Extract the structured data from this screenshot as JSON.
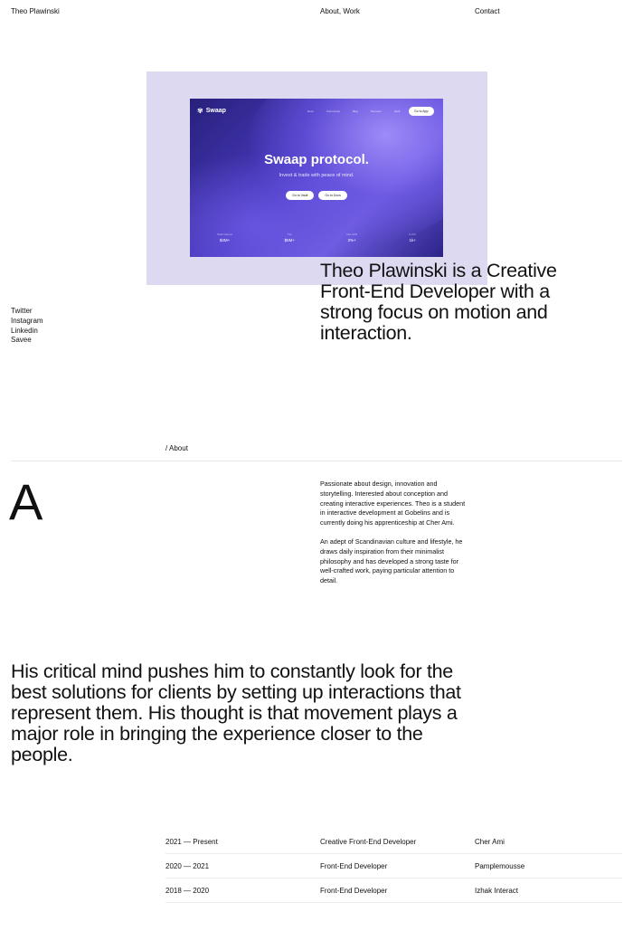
{
  "header": {
    "brand": "Theo Plawinski",
    "nav": "About, Work",
    "contact": "Contact"
  },
  "project": {
    "brand": "Swaap",
    "nav_links": [
      "Docs",
      "Community",
      "Blog",
      "Discover",
      "Vault"
    ],
    "cta": "Go to App",
    "title": "Swaap protocol.",
    "subtitle": "Invest & trade with peace of mind.",
    "buttons": [
      "Go to Vault",
      "Go to Docs"
    ],
    "stats": [
      {
        "label": "Total Volume",
        "value": "$4M+"
      },
      {
        "label": "TVL",
        "value": "$5M+"
      },
      {
        "label": "Net APR",
        "value": "2%+"
      },
      {
        "label": "# LPs",
        "value": "1k+"
      }
    ],
    "colors": {
      "card_bg": "#dcd9f1",
      "mock_primary": "#4a3bc4"
    }
  },
  "intro": "Theo Plawinski is a Creative Front-End Developer with a strong focus on motion and interaction.",
  "socials": [
    "Twitter",
    "Instagram",
    "Linkedin",
    "Savee"
  ],
  "about": {
    "label": "/ About",
    "letter": "A",
    "paragraphs": [
      "Passionate about design, innovation and storytelling. Interested about conception and creating interactive experiences. Theo is a student in interactive development at Gobelins and is currently doing his apprenticeship at Cher Ami.",
      "An adept of Scandinavian culture and lifestyle, he draws daily inspiration from their minimalist philosophy and has developed a strong taste for well-crafted work, paying particular attention to detail."
    ]
  },
  "statement": "His critical mind pushes him to constantly look for the best solutions for clients by setting up interactions that represent them. His thought is that movement plays a major role in bringing the experience closer to the people.",
  "experience": [
    {
      "years": "2021 — Present",
      "role": "Creative Front-End Developer",
      "company": "Cher Ami"
    },
    {
      "years": "2020 — 2021",
      "role": "Front-End Developer",
      "company": "Pamplemousse"
    },
    {
      "years": "2018 — 2020",
      "role": "Front-End Developer",
      "company": "Izhak Interact"
    }
  ]
}
